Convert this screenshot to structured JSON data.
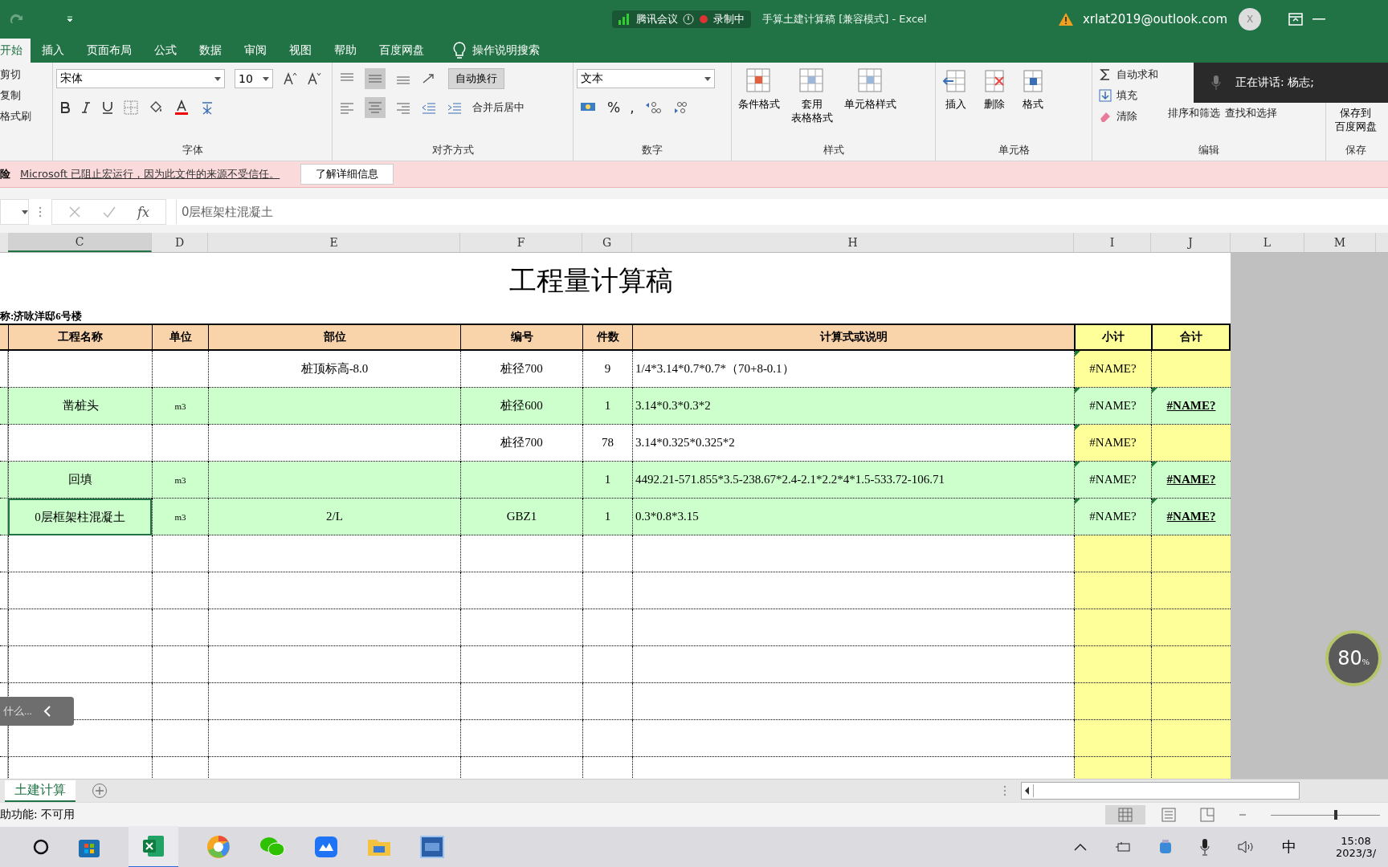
{
  "window": {
    "title": "手算土建计算稿 [兼容模式] - Excel",
    "account": "xrlat2019@outlook.com",
    "avatar": "X"
  },
  "meeting_overlay": {
    "app": "腾讯会议",
    "recording": "录制中"
  },
  "tabs": [
    {
      "label": "开始",
      "selected": true
    },
    {
      "label": "插入",
      "selected": false
    },
    {
      "label": "页面布局",
      "selected": false
    },
    {
      "label": "公式",
      "selected": false
    },
    {
      "label": "数据",
      "selected": false
    },
    {
      "label": "审阅",
      "selected": false
    },
    {
      "label": "视图",
      "selected": false
    },
    {
      "label": "帮助",
      "selected": false
    },
    {
      "label": "百度网盘",
      "selected": false
    }
  ],
  "tell_me": "操作说明搜索",
  "ribbon": {
    "clipboard": [
      "剪切",
      "复制",
      "格式刷"
    ],
    "font": {
      "name": "宋体",
      "size": "10",
      "label": "字体"
    },
    "alignment": {
      "wrap": "自动换行",
      "merge": "合并后居中",
      "label": "对齐方式"
    },
    "number": {
      "format": "文本",
      "percent": "%",
      "comma": ",",
      "label": "数字"
    },
    "styles": {
      "items": [
        [
          "条件格式"
        ],
        [
          "套用",
          "表格格式"
        ],
        [
          "单元格样式"
        ]
      ],
      "label": "样式"
    },
    "cells": {
      "items": [
        "插入",
        "删除",
        "格式"
      ],
      "label": "单元格"
    },
    "editing": {
      "items": [
        "自动求和",
        "填充",
        "清除"
      ],
      "sort": "排序和筛选",
      "find": "查找和选择",
      "label": "编辑"
    },
    "save": {
      "item": [
        "保存到",
        "百度网盘"
      ],
      "label": "保存"
    }
  },
  "speaking": "正在讲话: 杨志;",
  "message_bar": {
    "prefix": "险",
    "text": "Microsoft 已阻止宏运行，因为此文件的来源不受信任。",
    "button": "了解详细信息"
  },
  "formula_bar": {
    "fx": "fx",
    "content": "0层框架柱混凝土"
  },
  "columns": [
    {
      "label": "C",
      "selected": true
    },
    {
      "label": "D",
      "selected": false
    },
    {
      "label": "E",
      "selected": false
    },
    {
      "label": "F",
      "selected": false
    },
    {
      "label": "G",
      "selected": false
    },
    {
      "label": "H",
      "selected": false
    },
    {
      "label": "I",
      "selected": false
    },
    {
      "label": "J",
      "selected": false
    },
    {
      "label": "L",
      "selected": false
    },
    {
      "label": "M",
      "selected": false
    }
  ],
  "sheet": {
    "title": "工程量计算稿",
    "subtitle": "称:济咏洋邸6号楼",
    "headers": [
      "工程名称",
      "单位",
      "部位",
      "编号",
      "件数",
      "计算式或说明",
      "小计",
      "合计"
    ],
    "rows": [
      {
        "cells": [
          "",
          "",
          "桩顶标高-8.0",
          "桩径700",
          "9",
          "1/4*3.14*0.7*0.7*（70+8-0.1）",
          "#NAME?",
          ""
        ],
        "highlighted": false,
        "selected": false
      },
      {
        "cells": [
          "凿桩头",
          "m3",
          "",
          "桩径600",
          "1",
          "3.14*0.3*0.3*2",
          "#NAME?",
          "#NAME?"
        ],
        "highlighted": true,
        "selected": false
      },
      {
        "cells": [
          "",
          "",
          "",
          "桩径700",
          "78",
          "3.14*0.325*0.325*2",
          "#NAME?",
          ""
        ],
        "highlighted": false,
        "selected": false
      },
      {
        "cells": [
          "回填",
          "m3",
          "",
          "",
          "1",
          "4492.21-571.855*3.5-238.67*2.4-2.1*2.2*4*1.5-533.72-106.71",
          "#NAME?",
          "#NAME?"
        ],
        "highlighted": true,
        "selected": false
      },
      {
        "cells": [
          "0层框架柱混凝土",
          "m3",
          "2/L",
          "GBZ1",
          "1",
          "0.3*0.8*3.15",
          "#NAME?",
          "#NAME?"
        ],
        "highlighted": true,
        "selected": true
      },
      {
        "cells": [
          "",
          "",
          "",
          "",
          "",
          "",
          "",
          ""
        ],
        "highlighted": false,
        "selected": false
      },
      {
        "cells": [
          "",
          "",
          "",
          "",
          "",
          "",
          "",
          ""
        ],
        "highlighted": false,
        "selected": false
      },
      {
        "cells": [
          "",
          "",
          "",
          "",
          "",
          "",
          "",
          ""
        ],
        "highlighted": false,
        "selected": false
      },
      {
        "cells": [
          "",
          "",
          "",
          "",
          "",
          "",
          "",
          ""
        ],
        "highlighted": false,
        "selected": false
      },
      {
        "cells": [
          "",
          "",
          "",
          "",
          "",
          "",
          "",
          ""
        ],
        "highlighted": false,
        "selected": false
      },
      {
        "cells": [
          "",
          "",
          "",
          "",
          "",
          "",
          "",
          ""
        ],
        "highlighted": false,
        "selected": false
      },
      {
        "cells": [
          "",
          "",
          "",
          "",
          "",
          "",
          "",
          ""
        ],
        "highlighted": false,
        "selected": false
      }
    ]
  },
  "hint_pill": "什么...",
  "zoom_badge": {
    "value": "80",
    "unit": "%"
  },
  "sheet_tabs": [
    {
      "label": "土建计算",
      "selected": true
    }
  ],
  "status_bar": "助功能: 不可用",
  "zoom_slider": {
    "level": 0.58
  },
  "taskbar": {
    "time": "15:08",
    "date": "2023/3/",
    "ime": "中"
  }
}
